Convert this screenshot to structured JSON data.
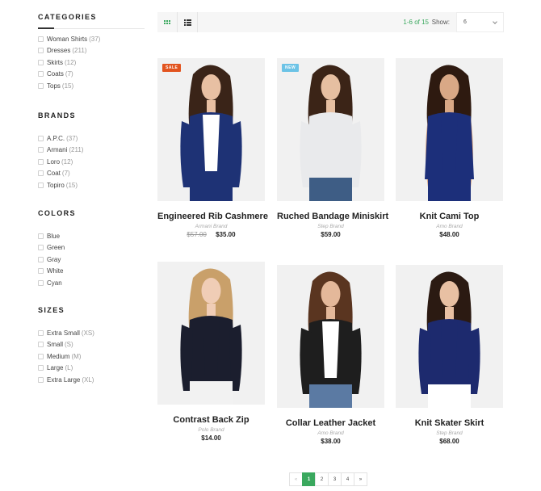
{
  "sidebar": {
    "categories": {
      "title": "CATEGORIES",
      "items": [
        {
          "label": "Woman Shirts",
          "count": "(37)"
        },
        {
          "label": "Dresses",
          "count": "(211)"
        },
        {
          "label": "Skirts",
          "count": "(12)"
        },
        {
          "label": "Coats",
          "count": "(7)"
        },
        {
          "label": "Tops",
          "count": "(15)"
        }
      ]
    },
    "brands": {
      "title": "BRANDS",
      "items": [
        {
          "label": "A.P.C.",
          "count": "(37)"
        },
        {
          "label": "Armani",
          "count": "(211)"
        },
        {
          "label": "Loro",
          "count": "(12)"
        },
        {
          "label": "Coat",
          "count": "(7)"
        },
        {
          "label": "Topiro",
          "count": "(15)"
        }
      ]
    },
    "colors": {
      "title": "COLORS",
      "items": [
        {
          "label": "Blue"
        },
        {
          "label": "Green"
        },
        {
          "label": "Gray"
        },
        {
          "label": "White"
        },
        {
          "label": "Cyan"
        }
      ]
    },
    "sizes": {
      "title": "SIZES",
      "items": [
        {
          "label": "Extra Small",
          "count": "(XS)"
        },
        {
          "label": "Small",
          "count": "(S)"
        },
        {
          "label": "Medium",
          "count": "(M)"
        },
        {
          "label": "Large",
          "count": "(L)"
        },
        {
          "label": "Extra Large",
          "count": "(XL)"
        }
      ]
    }
  },
  "toolbar": {
    "grid_view_icon": "grid-icon",
    "list_view_icon": "list-icon",
    "results": "1-6 of 15",
    "show_label": "Show:",
    "show_value": "6"
  },
  "products": [
    {
      "name": "Engineered Rib Cashmere",
      "brand": "Armani Brand",
      "old_price": "$57.00",
      "price": "$35.00",
      "badge": "SALE",
      "top_color": "#1e3275",
      "skin": "#e8c0a3",
      "hair": "#3a2418",
      "inner": "#ffffff",
      "bottom": "#1e3275"
    },
    {
      "name": "Ruched Bandage Miniskirt",
      "brand": "Step Brand",
      "price": "$59.00",
      "badge": "NEW",
      "top_color": "#e9eaec",
      "skin": "#e6bfa1",
      "hair": "#3b2417",
      "inner": "#e9eaec",
      "bottom": "#3e5d85"
    },
    {
      "name": "Knit Cami Top",
      "brand": "Amo Brand",
      "price": "$48.00",
      "top_color": "#1c2f7a",
      "skin": "#d9a886",
      "hair": "#2e1a10",
      "inner": "#1c2f7a",
      "bottom": "#1c2f7a"
    },
    {
      "name": "Contrast Back Zip",
      "brand": "Polo Brand",
      "price": "$14.00",
      "top_color": "#1b1e2e",
      "skin": "#f0cdb6",
      "hair": "#c9a06a",
      "inner": "#1b1e2e",
      "bottom": "#f2f2f2"
    },
    {
      "name": "Collar Leather Jacket",
      "brand": "Amo Brand",
      "price": "$38.00",
      "top_color": "#1e1e1e",
      "skin": "#e4b89a",
      "hair": "#5a3520",
      "inner": "#ffffff",
      "bottom": "#5b7aa3"
    },
    {
      "name": "Knit Skater Skirt",
      "brand": "Step Brand",
      "price": "$68.00",
      "top_color": "#1d2a6e",
      "skin": "#e8c0a3",
      "hair": "#2b1a12",
      "inner": "#1d2a6e",
      "bottom": "#ffffff"
    }
  ],
  "pagination": {
    "prev": "«",
    "pages": [
      "1",
      "2",
      "3",
      "4"
    ],
    "next": "»",
    "active": "1"
  }
}
